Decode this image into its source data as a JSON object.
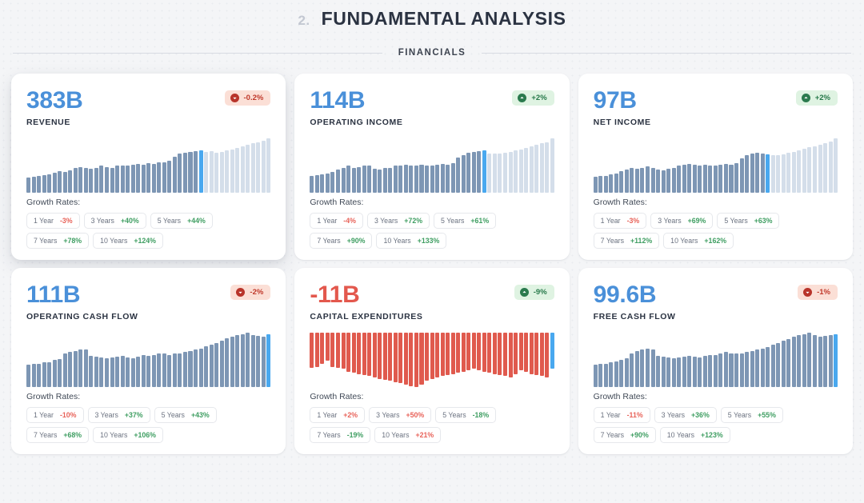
{
  "header": {
    "number": "2.",
    "title": "FUNDAMENTAL ANALYSIS"
  },
  "section": {
    "label": "FINANCIALS"
  },
  "colors": {
    "value_positive": "#4a90d9",
    "value_negative": "#e3584d",
    "bar_historic": "#7d96b4",
    "bar_projected": "#b9cadd",
    "bar_current": "#49a8ef",
    "bar_expense": "#e05a4e",
    "badge_up_bg": "#dff3e2",
    "badge_down_bg": "#fbdfd6",
    "growth_pos": "#3f9e62",
    "growth_neg": "#e8635a"
  },
  "growth_label": "Growth Rates:",
  "cards": [
    {
      "value": "383B",
      "label": "REVENUE",
      "value_sign": "positive",
      "badge": {
        "text": "-0.2%",
        "direction": "down",
        "icon": "circle-arrow-down-icon"
      },
      "elevated": true,
      "chart": {
        "type": "bar",
        "orientation": "up",
        "current_index": 33,
        "values": [
          22,
          23,
          24,
          25,
          26,
          29,
          31,
          30,
          32,
          35,
          37,
          36,
          34,
          36,
          38,
          37,
          36,
          38,
          39,
          38,
          40,
          41,
          40,
          42,
          41,
          43,
          44,
          46,
          51,
          55,
          57,
          58,
          59,
          60,
          58,
          59,
          57,
          58,
          60,
          62,
          64,
          66,
          68,
          70,
          72,
          74,
          78
        ]
      },
      "growth_rates": [
        {
          "period": "1 Year",
          "value": "-3%",
          "sign": "neg"
        },
        {
          "period": "3 Years",
          "value": "+40%",
          "sign": "pos"
        },
        {
          "period": "5 Years",
          "value": "+44%",
          "sign": "pos"
        },
        {
          "period": "7 Years",
          "value": "+78%",
          "sign": "pos"
        },
        {
          "period": "10 Years",
          "value": "+124%",
          "sign": "pos"
        }
      ]
    },
    {
      "value": "114B",
      "label": "OPERATING INCOME",
      "value_sign": "positive",
      "badge": {
        "text": "+2%",
        "direction": "up",
        "icon": "circle-arrow-up-icon"
      },
      "elevated": false,
      "chart": {
        "type": "bar",
        "orientation": "up",
        "current_index": 33,
        "values": [
          24,
          25,
          26,
          27,
          30,
          33,
          36,
          38,
          36,
          37,
          39,
          38,
          34,
          33,
          35,
          36,
          38,
          39,
          40,
          39,
          38,
          40,
          39,
          38,
          40,
          41,
          40,
          42,
          50,
          54,
          57,
          58,
          59,
          60,
          56,
          55,
          56,
          57,
          58,
          60,
          62,
          64,
          66,
          68,
          70,
          72,
          78
        ]
      },
      "growth_rates": [
        {
          "period": "1 Year",
          "value": "-4%",
          "sign": "neg"
        },
        {
          "period": "3 Years",
          "value": "+72%",
          "sign": "pos"
        },
        {
          "period": "5 Years",
          "value": "+61%",
          "sign": "pos"
        },
        {
          "period": "7 Years",
          "value": "+90%",
          "sign": "pos"
        },
        {
          "period": "10 Years",
          "value": "+133%",
          "sign": "pos"
        }
      ]
    },
    {
      "value": "97B",
      "label": "NET INCOME",
      "value_sign": "positive",
      "badge": {
        "text": "+2%",
        "direction": "up",
        "icon": "circle-arrow-up-icon"
      },
      "elevated": false,
      "chart": {
        "type": "bar",
        "orientation": "up",
        "current_index": 33,
        "values": [
          23,
          24,
          25,
          26,
          28,
          31,
          34,
          36,
          35,
          36,
          38,
          37,
          34,
          33,
          35,
          36,
          39,
          41,
          42,
          41,
          40,
          41,
          40,
          39,
          41,
          42,
          41,
          43,
          50,
          55,
          57,
          58,
          57,
          56,
          54,
          55,
          56,
          58,
          60,
          62,
          64,
          66,
          68,
          70,
          72,
          74,
          80
        ]
      },
      "growth_rates": [
        {
          "period": "1 Year",
          "value": "-3%",
          "sign": "neg"
        },
        {
          "period": "3 Years",
          "value": "+69%",
          "sign": "pos"
        },
        {
          "period": "5 Years",
          "value": "+63%",
          "sign": "pos"
        },
        {
          "period": "7 Years",
          "value": "+112%",
          "sign": "pos"
        },
        {
          "period": "10 Years",
          "value": "+162%",
          "sign": "pos"
        }
      ]
    },
    {
      "value": "111B",
      "label": "OPERATING CASH FLOW",
      "value_sign": "positive",
      "badge": {
        "text": "-2%",
        "direction": "down",
        "icon": "circle-arrow-down-icon"
      },
      "elevated": false,
      "chart": {
        "type": "bar",
        "orientation": "up",
        "current_index": 46,
        "values": [
          30,
          31,
          32,
          33,
          34,
          36,
          38,
          45,
          47,
          49,
          51,
          50,
          42,
          41,
          40,
          39,
          40,
          41,
          42,
          40,
          39,
          41,
          43,
          42,
          44,
          46,
          45,
          44,
          45,
          46,
          47,
          48,
          50,
          52,
          55,
          58,
          60,
          63,
          66,
          68,
          70,
          72,
          74,
          70,
          69,
          68,
          72
        ]
      },
      "growth_rates": [
        {
          "period": "1 Year",
          "value": "-10%",
          "sign": "neg"
        },
        {
          "period": "3 Years",
          "value": "+37%",
          "sign": "pos"
        },
        {
          "period": "5 Years",
          "value": "+43%",
          "sign": "pos"
        },
        {
          "period": "7 Years",
          "value": "+68%",
          "sign": "pos"
        },
        {
          "period": "10 Years",
          "value": "+106%",
          "sign": "pos"
        }
      ]
    },
    {
      "value": "-11B",
      "label": "CAPITAL EXPENDITURES",
      "value_sign": "negative",
      "badge": {
        "text": "-9%",
        "direction": "up",
        "icon": "circle-arrow-up-icon"
      },
      "elevated": false,
      "chart": {
        "type": "bar",
        "orientation": "down",
        "current_index": 46,
        "values": [
          60,
          58,
          52,
          48,
          58,
          60,
          62,
          66,
          68,
          70,
          72,
          74,
          75,
          78,
          80,
          82,
          84,
          86,
          88,
          90,
          92,
          88,
          82,
          78,
          76,
          74,
          72,
          70,
          68,
          66,
          64,
          62,
          64,
          66,
          68,
          70,
          72,
          74,
          76,
          70,
          64,
          66,
          70,
          72,
          74,
          76,
          62
        ]
      },
      "growth_rates": [
        {
          "period": "1 Year",
          "value": "+2%",
          "sign": "neg"
        },
        {
          "period": "3 Years",
          "value": "+50%",
          "sign": "neg"
        },
        {
          "period": "5 Years",
          "value": "-18%",
          "sign": "pos"
        },
        {
          "period": "7 Years",
          "value": "-19%",
          "sign": "pos"
        },
        {
          "period": "10 Years",
          "value": "+21%",
          "sign": "neg"
        }
      ]
    },
    {
      "value": "99.6B",
      "label": "FREE CASH FLOW",
      "value_sign": "positive",
      "badge": {
        "text": "-1%",
        "direction": "down",
        "icon": "circle-arrow-down-icon"
      },
      "elevated": false,
      "chart": {
        "type": "bar",
        "orientation": "up",
        "current_index": 46,
        "values": [
          30,
          31,
          32,
          33,
          35,
          37,
          39,
          46,
          48,
          50,
          52,
          51,
          42,
          41,
          40,
          39,
          40,
          41,
          42,
          41,
          40,
          42,
          44,
          43,
          45,
          47,
          46,
          45,
          46,
          47,
          48,
          50,
          52,
          54,
          57,
          60,
          62,
          65,
          68,
          70,
          72,
          74,
          70,
          68,
          69,
          70,
          72
        ]
      },
      "growth_rates": [
        {
          "period": "1 Year",
          "value": "-11%",
          "sign": "neg"
        },
        {
          "period": "3 Years",
          "value": "+36%",
          "sign": "pos"
        },
        {
          "period": "5 Years",
          "value": "+55%",
          "sign": "pos"
        },
        {
          "period": "7 Years",
          "value": "+90%",
          "sign": "pos"
        },
        {
          "period": "10 Years",
          "value": "+123%",
          "sign": "pos"
        }
      ]
    }
  ]
}
